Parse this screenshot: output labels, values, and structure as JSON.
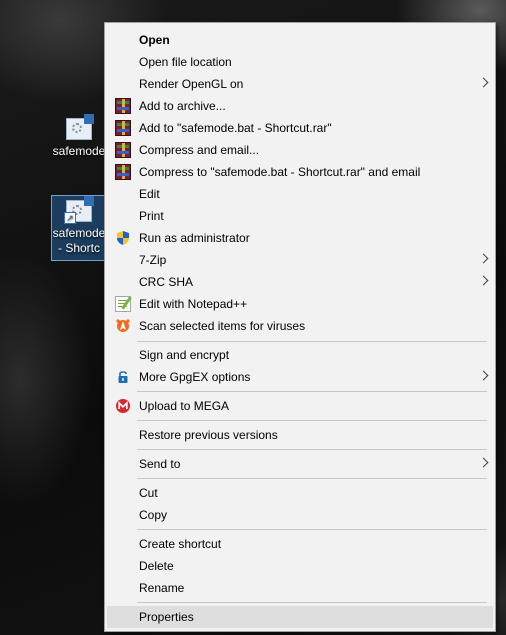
{
  "desktop": {
    "icons": [
      {
        "label": "safemode"
      },
      {
        "label_line1": "safemode",
        "label_line2": "- Shortc"
      }
    ]
  },
  "menu": {
    "items": [
      {
        "label": "Open",
        "bold": true
      },
      {
        "label": "Open file location"
      },
      {
        "label": "Render OpenGL on",
        "submenu": true
      },
      {
        "label": "Add to archive...",
        "icon": "winrar-icon"
      },
      {
        "label": "Add to \"safemode.bat - Shortcut.rar\"",
        "icon": "winrar-icon"
      },
      {
        "label": "Compress and email...",
        "icon": "winrar-icon"
      },
      {
        "label": "Compress to \"safemode.bat - Shortcut.rar\" and email",
        "icon": "winrar-icon"
      },
      {
        "label": "Edit"
      },
      {
        "label": "Print"
      },
      {
        "label": "Run as administrator",
        "icon": "uac-shield-icon"
      },
      {
        "label": "7-Zip",
        "submenu": true
      },
      {
        "label": "CRC SHA",
        "submenu": true
      },
      {
        "label": "Edit with Notepad++",
        "icon": "notepadpp-icon"
      },
      {
        "label": "Scan selected items for viruses",
        "icon": "avast-icon"
      },
      {
        "label": "Sign and encrypt"
      },
      {
        "label": "More GpgEX options",
        "icon": "padlock-icon",
        "submenu": true
      },
      {
        "label": "Upload to MEGA",
        "icon": "mega-icon"
      },
      {
        "label": "Restore previous versions"
      },
      {
        "label": "Send to",
        "submenu": true
      },
      {
        "label": "Cut"
      },
      {
        "label": "Copy"
      },
      {
        "label": "Create shortcut"
      },
      {
        "label": "Delete"
      },
      {
        "label": "Rename"
      },
      {
        "label": "Properties",
        "highlighted": true
      }
    ]
  },
  "colors": {
    "menu_bg": "#f2f2f2",
    "hover_bg": "#dedede",
    "separator": "#c8c8c8",
    "avast_orange": "#f26b1d",
    "mega_red": "#d9272e",
    "uac_blue": "#1e63c8",
    "uac_yellow": "#f4c430"
  }
}
